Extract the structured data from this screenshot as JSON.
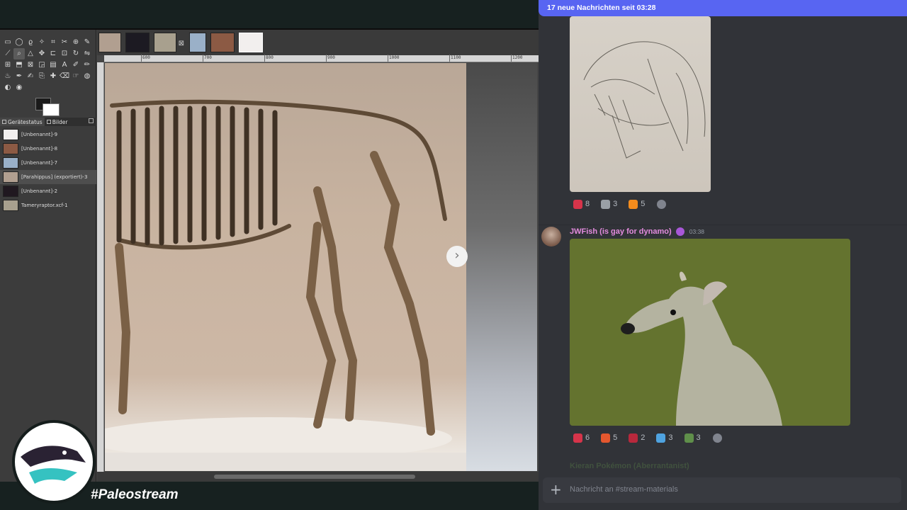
{
  "gimp": {
    "panel_tabs": [
      "Gerätestatus",
      "Bilder"
    ],
    "images": [
      {
        "label": "[Unbenannt]-9",
        "thumb_color": "#f2efee"
      },
      {
        "label": "[Unbenannt]-8",
        "thumb_color": "#8c5a44"
      },
      {
        "label": "[Unbenannt]-7",
        "thumb_color": "#9ab0c8"
      },
      {
        "label": "[Parahippus] (exportiert)-3",
        "thumb_color": "#b19f90"
      },
      {
        "label": "[Unbenannt]-2",
        "thumb_color": "#201820"
      },
      {
        "label": "Tameryraptor.xcf-1",
        "thumb_color": "#a8a08e"
      }
    ],
    "ruler_labels": [
      "600",
      "700",
      "800",
      "900",
      "1000",
      "1100",
      "1200"
    ],
    "colors": {
      "foreground": "#1a1a1a",
      "background": "#ffffff"
    }
  },
  "stream": {
    "hashtag": "#Paleostream"
  },
  "discord": {
    "new_messages_banner": "17 neue Nachrichten seit 03:28",
    "message1_reactions": [
      {
        "emoji": "red-heart",
        "color": "#d6344a",
        "count": "8"
      },
      {
        "emoji": "sticker",
        "color": "#9aa0a6",
        "count": "3"
      },
      {
        "emoji": "fire",
        "color": "#f48c1d",
        "count": "5"
      }
    ],
    "message2": {
      "author": "JWFish (is gay for dynamo)",
      "time": "03:38",
      "reactions": [
        {
          "emoji": "red-heart",
          "color": "#d6344a",
          "count": "6"
        },
        {
          "emoji": "heart-on-fire",
          "color": "#e4572e",
          "count": "5"
        },
        {
          "emoji": "heart-face",
          "color": "#b8283c",
          "count": "2"
        },
        {
          "emoji": "gem",
          "color": "#4fa3e0",
          "count": "3"
        },
        {
          "emoji": "green-face",
          "color": "#5f8f4a",
          "count": "3"
        }
      ]
    },
    "next_author": "Kieran Pokémon (Aberrantanist)",
    "composer_placeholder": "Nachricht an #stream-materials"
  }
}
